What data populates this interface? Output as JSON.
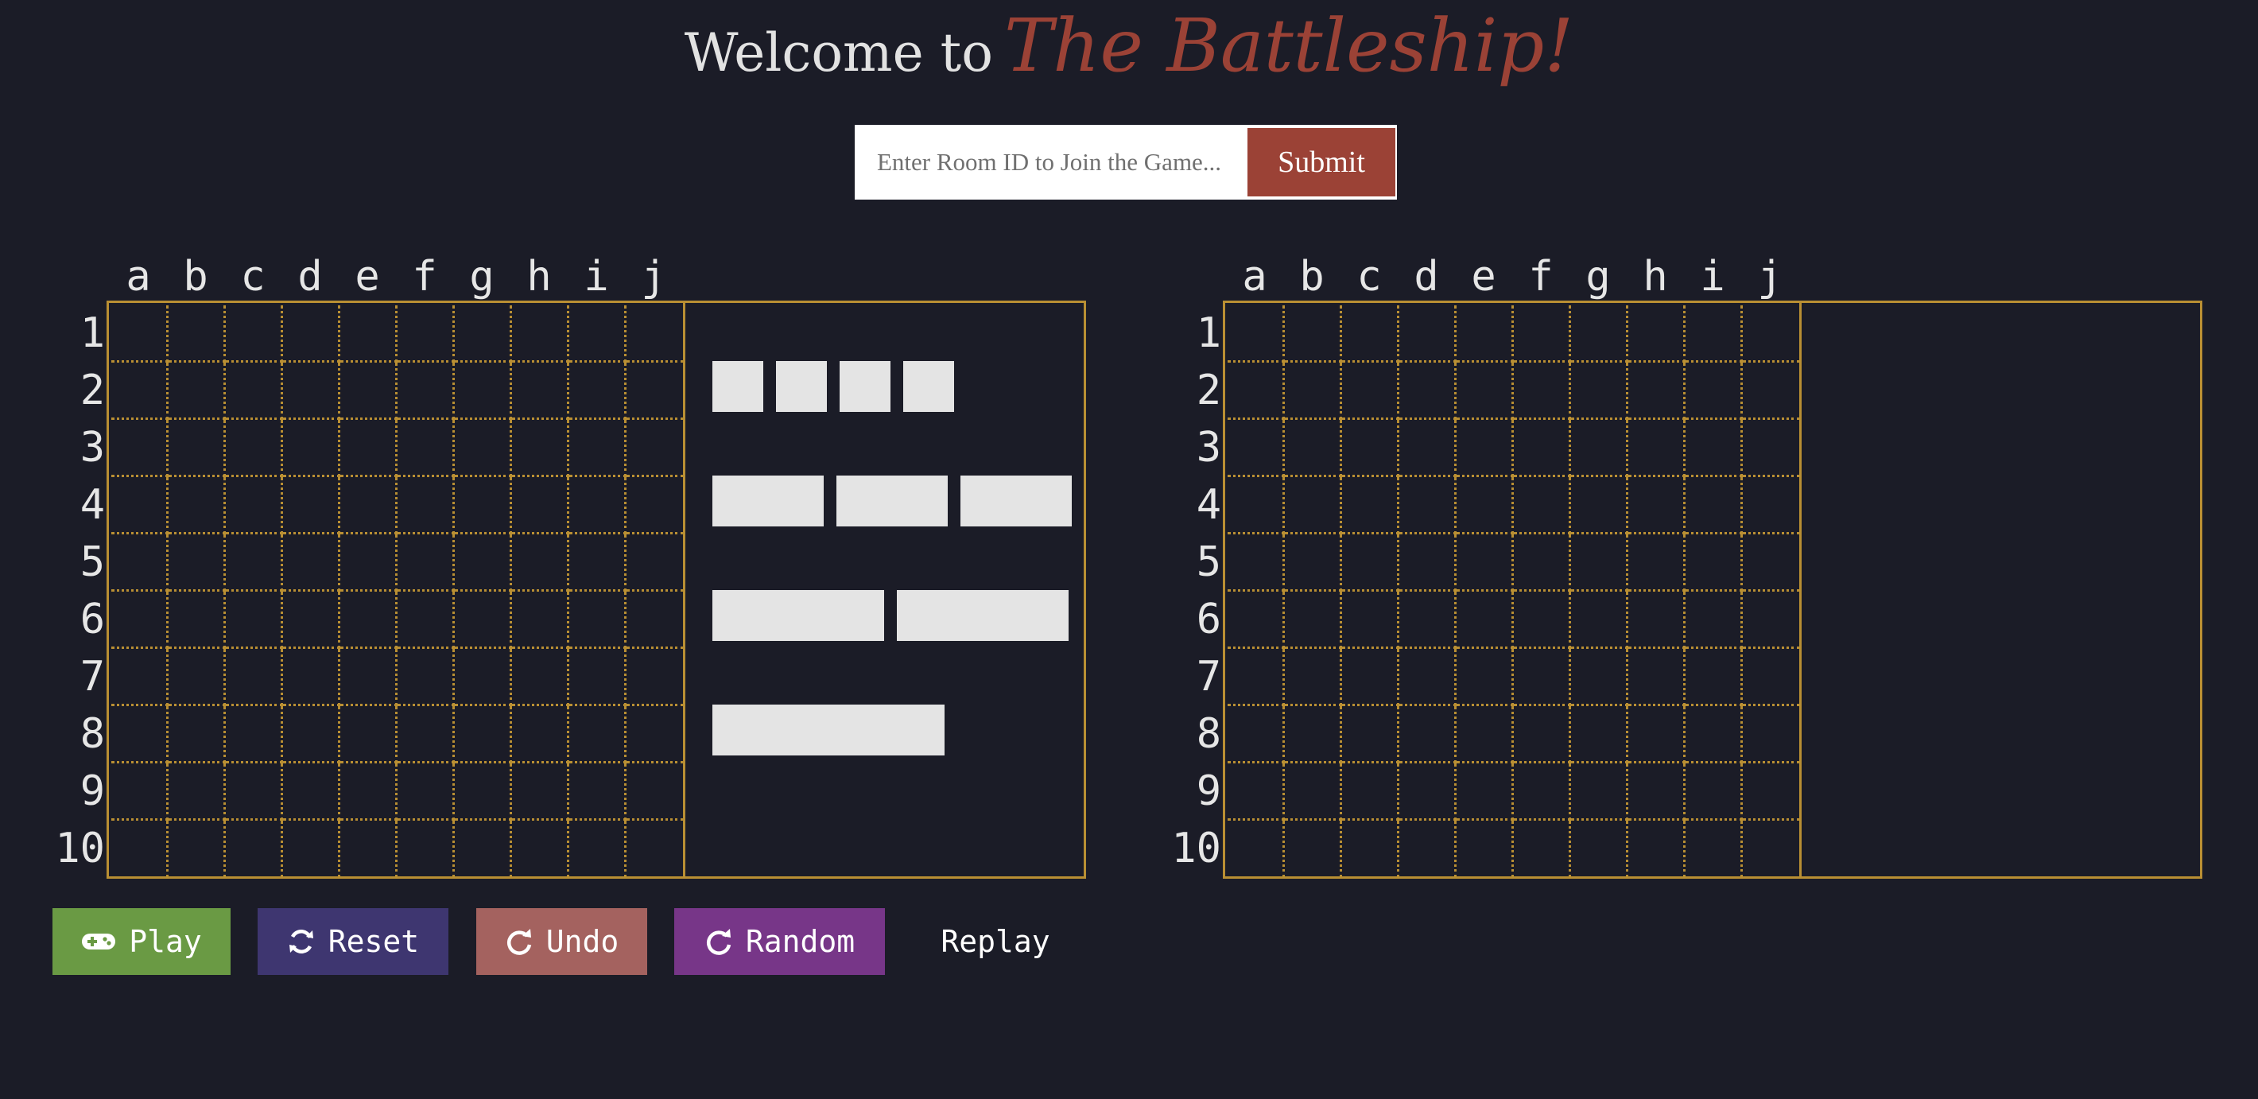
{
  "header": {
    "welcome": "Welcome to",
    "brand": "The Battleship!",
    "brand_color": "#9b4236"
  },
  "join": {
    "placeholder": "Enter Room ID to Join the Game...",
    "submit_label": "Submit",
    "submit_color": "#9b4236"
  },
  "board": {
    "columns": [
      "a",
      "b",
      "c",
      "d",
      "e",
      "f",
      "g",
      "h",
      "i",
      "j"
    ],
    "rows": [
      "1",
      "2",
      "3",
      "4",
      "5",
      "6",
      "7",
      "8",
      "9",
      "10"
    ],
    "grid_color": "#b98f33"
  },
  "fleet": [
    {
      "size": 1,
      "count": 4
    },
    {
      "size": 2,
      "count": 3
    },
    {
      "size": 3,
      "count": 2
    },
    {
      "size": 4,
      "count": 1
    }
  ],
  "controls": {
    "play": {
      "label": "Play",
      "icon": "gamepad-icon",
      "color": "#6a9a44"
    },
    "reset": {
      "label": "Reset",
      "icon": "refresh-icon",
      "color": "#3e3670"
    },
    "undo": {
      "label": "Undo",
      "icon": "redo-arrow-icon",
      "color": "#a4625f"
    },
    "random": {
      "label": "Random",
      "icon": "redo-arrow-icon",
      "color": "#773688"
    },
    "replay": {
      "label": "Replay"
    }
  }
}
